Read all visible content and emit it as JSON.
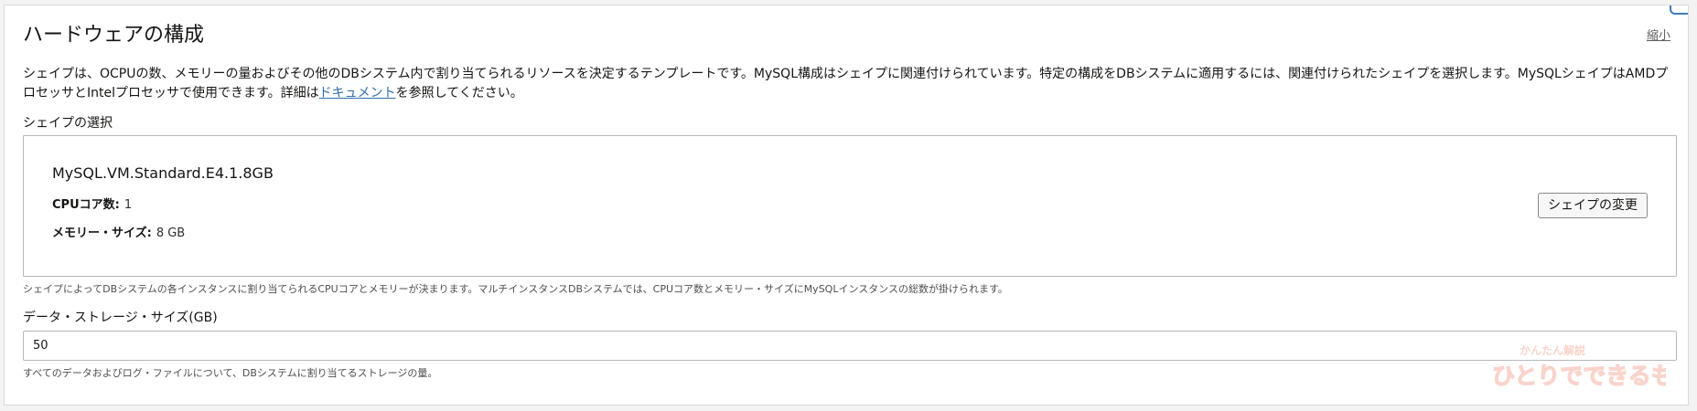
{
  "section": {
    "title": "ハードウェアの構成",
    "collapse_label": "縮小",
    "description_before_link": "シェイプは、OCPUの数、メモリーの量およびその他のDBシステム内で割り当てられるリソースを決定するテンプレートです。MySQL構成はシェイプに関連付けられています。特定の構成をDBシステムに適用するには、関連付けられたシェイプを選択します。MySQLシェイプはAMDプロセッサとIntelプロセッサで使用できます。詳細は",
    "description_link": "ドキュメント",
    "description_after_link": "を参照してください。"
  },
  "shape_selection": {
    "label": "シェイプの選択",
    "shape_name": "MySQL.VM.Standard.E4.1.8GB",
    "cpu_label": "CPUコア数:",
    "cpu_value": "1",
    "memory_label": "メモリー・サイズ:",
    "memory_value": "8 GB",
    "change_button_label": "シェイプの変更",
    "help_text": "シェイプによってDBシステムの各インスタンスに割り当てられるCPUコアとメモリーが決まります。マルチインスタンスDBシステムでは、CPUコア数とメモリー・サイズにMySQLインスタンスの総数が掛けられます。"
  },
  "data_storage": {
    "label": "データ・ストレージ・サイズ(GB)",
    "value": "50",
    "help_text": "すべてのデータおよびログ・ファイルについて、DBシステムに割り当てるストレージの量。"
  },
  "watermark": {
    "small_text": "かんたん解説",
    "main_text": "ひとりでできるもん"
  },
  "colors": {
    "link": "#2f6eaa",
    "accent": "#3b7bbd",
    "watermark": "#f2a28f"
  },
  "icons": {
    "top_accent": "corner-accent-icon"
  }
}
